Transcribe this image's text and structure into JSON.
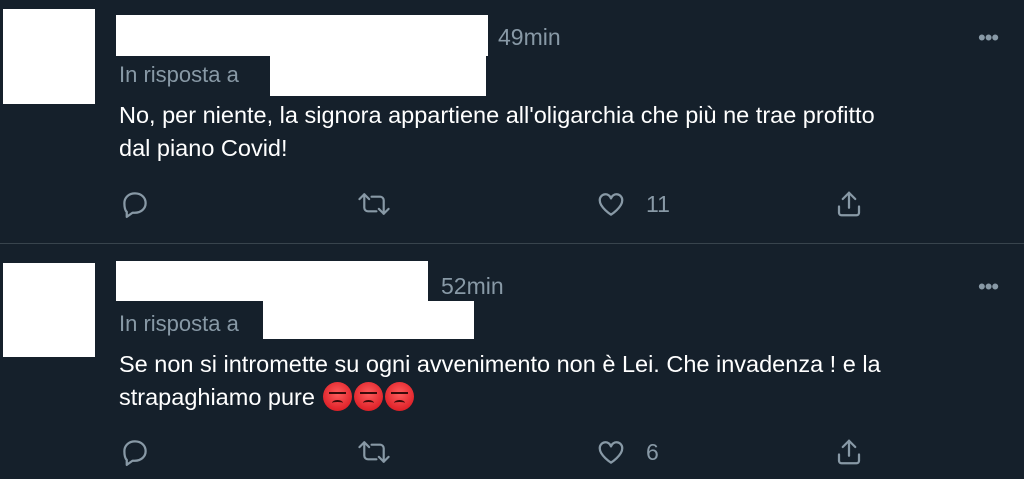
{
  "tweets": [
    {
      "time": "49min",
      "reply_prefix": "In risposta a",
      "text_line1": "No, per niente, la signora appartiene all'oligarchia che più ne trae profitto",
      "text_line2": "dal piano Covid!",
      "like_count": "11"
    },
    {
      "time": "52min",
      "reply_prefix": "In risposta a",
      "text_line1": "Se non si intromette su ogni avvenimento non è Lei. Che invadenza ! e la",
      "text_line2": "strapaghiamo pure",
      "like_count": "6",
      "emojis": [
        "angry-face",
        "angry-face",
        "angry-face"
      ]
    }
  ],
  "more_label": "•••",
  "icons": {
    "reply": "reply-icon",
    "retweet": "retweet-icon",
    "like": "heart-icon",
    "share": "share-icon"
  },
  "colors": {
    "background": "#15202b",
    "muted": "#8899a6",
    "divider": "#38444d",
    "text": "#ffffff"
  }
}
